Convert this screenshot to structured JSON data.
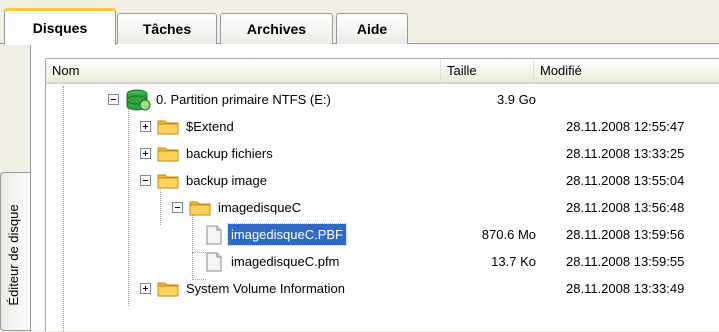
{
  "tabs": [
    "Disques",
    "Tâches",
    "Archives",
    "Aide"
  ],
  "side_tab": {
    "label": "Éditeur de disque"
  },
  "columns": {
    "name": "Nom",
    "size": "Taille",
    "modified": "Modifié"
  },
  "rows": [
    {
      "name": "0. Partition primaire NTFS (E:)",
      "size": "3.9 Go",
      "modified": "",
      "icon": "partition-icon",
      "expander": "collapse",
      "level": 0
    },
    {
      "name": "$Extend",
      "size": "",
      "modified": "28.11.2008 12:55:47",
      "icon": "folder-icon",
      "expander": "expand",
      "level": 1
    },
    {
      "name": "backup fichiers",
      "size": "",
      "modified": "28.11.2008 13:33:25",
      "icon": "folder-icon",
      "expander": "expand",
      "level": 1
    },
    {
      "name": "backup image",
      "size": "",
      "modified": "28.11.2008 13:55:04",
      "icon": "folder-icon",
      "expander": "collapse",
      "level": 1
    },
    {
      "name": "imagedisqueC",
      "size": "",
      "modified": "28.11.2008 13:56:48",
      "icon": "folder-icon",
      "expander": "collapse",
      "level": 2
    },
    {
      "name": "imagedisqueC.PBF",
      "size": "870.6 Mo",
      "modified": "28.11.2008 13:59:56",
      "icon": "file-icon",
      "expander": "",
      "level": 3,
      "selected": true
    },
    {
      "name": "imagedisqueC.pfm",
      "size": "13.7 Ko",
      "modified": "28.11.2008 13:59:55",
      "icon": "file-icon",
      "expander": "",
      "level": 3
    },
    {
      "name": "System Volume Information",
      "size": "",
      "modified": "28.11.2008 13:33:49",
      "icon": "folder-icon",
      "expander": "expand",
      "level": 1
    }
  ],
  "colors": {
    "selection": "#316ac5",
    "active_tab_accent": "#ffc83c",
    "folder": "#f7b829"
  }
}
